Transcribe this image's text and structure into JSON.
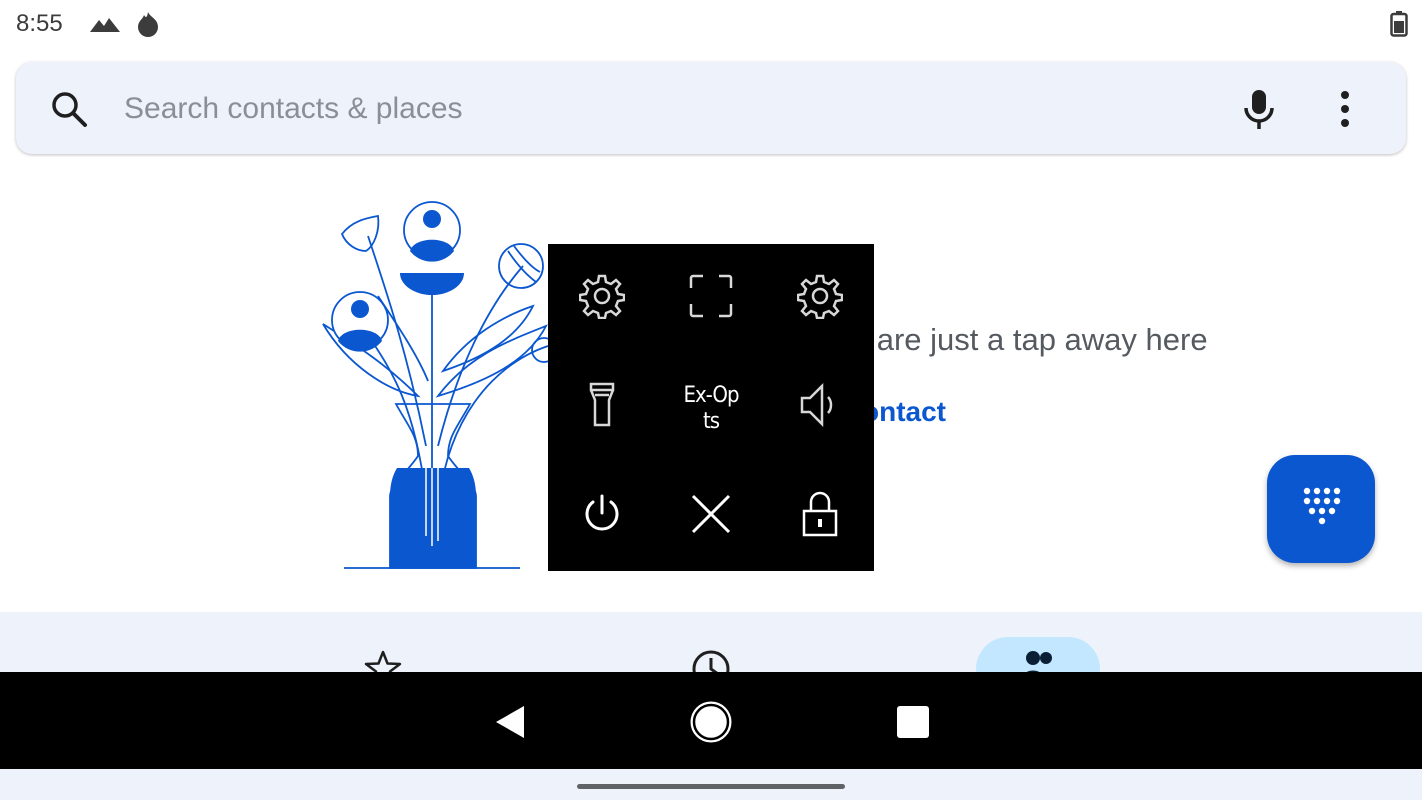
{
  "status_bar": {
    "time": "8:55",
    "icons": [
      "signal-mountain-icon",
      "flame-icon",
      "battery-icon"
    ]
  },
  "search": {
    "placeholder": "Search contacts & places",
    "icons": [
      "search-icon",
      "mic-icon",
      "more-vert-icon"
    ]
  },
  "empty_state": {
    "message_visible": "ts are just a tap away here",
    "link_visible": "ontact"
  },
  "overlay_panel": {
    "items": [
      {
        "icon": "gear-icon"
      },
      {
        "icon": "fullscreen-icon"
      },
      {
        "icon": "gear-icon"
      },
      {
        "icon": "flashlight-icon"
      },
      {
        "label": "Ex-Opts",
        "label_visible": "Ex-Op ts"
      },
      {
        "icon": "volume-icon"
      },
      {
        "icon": "power-icon"
      },
      {
        "icon": "close-icon"
      },
      {
        "icon": "lock-icon"
      }
    ]
  },
  "fab": {
    "icon": "dialpad-icon"
  },
  "bottom_nav": {
    "items": [
      {
        "icon": "star-icon",
        "selected": false
      },
      {
        "icon": "clock-icon",
        "selected": false
      },
      {
        "icon": "people-icon",
        "selected": true
      }
    ]
  },
  "system_nav": {
    "icons": [
      "back-icon",
      "home-icon",
      "recents-icon"
    ]
  },
  "colors": {
    "accent": "#0b57d0",
    "surface": "#eef2fa",
    "overlay": "#000000"
  }
}
